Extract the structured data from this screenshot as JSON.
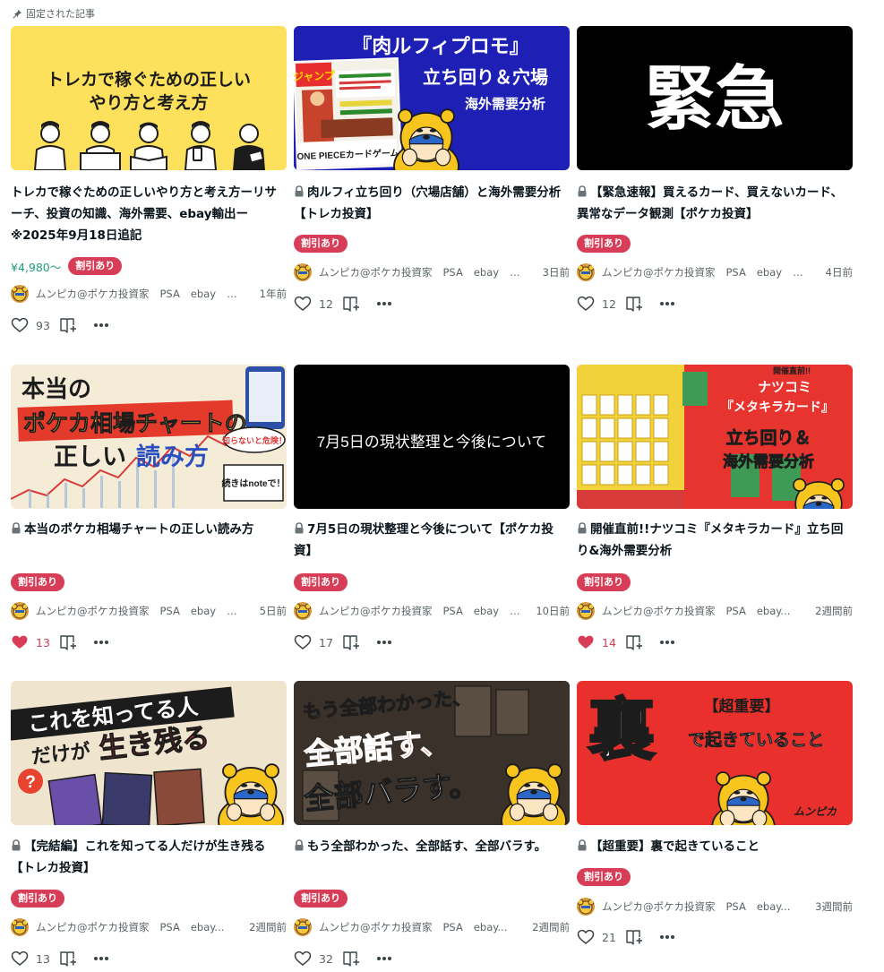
{
  "section_label": "固定された記事",
  "cards": [
    {
      "title": "トレカで稼ぐための正しいやり方と考え方ーリサーチ、投資の知識、海外需要、ebay輸出ー※2025年9月18日追記",
      "price": "¥4,980〜",
      "badge": "割引あり",
      "author": "ムンピカ@ポケカ投資家",
      "tags": [
        "PSA",
        "ebay"
      ],
      "ellipsis": "…",
      "time": "1年前",
      "likes": "93",
      "thumb": {
        "lines": [
          "トレカで稼ぐための正しい",
          "やり方と考え方"
        ]
      }
    },
    {
      "title": "肉ルフィ立ち回り（穴場店舗）と海外需要分析【トレカ投資】",
      "badge": "割引あり",
      "author": "ムンピカ@ポケカ投資家",
      "tags": [
        "PSA",
        "ebay"
      ],
      "ellipsis": "…",
      "time": "3日前",
      "likes": "12",
      "thumb": {
        "heading": "『肉ルフィプロモ』",
        "line1": "立ち回り＆穴場",
        "line2": "海外需要分析",
        "cover_logo": "ジャンプ",
        "cover_caption": "ONE PIECEカードゲーム"
      }
    },
    {
      "title": "【緊急速報】買えるカード、買えないカード、異常なデータ観測【ポケカ投資】",
      "badge": "割引あり",
      "author": "ムンピカ@ポケカ投資家",
      "tags": [
        "PSA",
        "ebay"
      ],
      "ellipsis": "…",
      "time": "4日前",
      "likes": "12",
      "thumb": {
        "text": "緊急"
      }
    },
    {
      "title": "本当のポケカ相場チャートの正しい読み方",
      "badge": "割引あり",
      "author": "ムンピカ@ポケカ投資家",
      "tags": [
        "PSA",
        "ebay"
      ],
      "ellipsis": "…",
      "time": "5日前",
      "likes": "13",
      "liked": true,
      "thumb": {
        "line1": "本当の",
        "line2": "ポケカ相場チャートの",
        "line3a": "正しい",
        "line3b": "読み方",
        "bubble": "知らないと危険！",
        "note": "続きはnoteで！"
      }
    },
    {
      "title": "7月5日の現状整理と今後について【ポケカ投資】",
      "badge": "割引あり",
      "author": "ムンピカ@ポケカ投資家",
      "tags": [
        "PSA",
        "ebay"
      ],
      "ellipsis": "…",
      "time": "10日前",
      "likes": "17",
      "thumb": {
        "text": "7月5日の現状整理と今後について"
      }
    },
    {
      "title": "開催直前!!ナツコミ『メタキラカード』立ち回り&海外需要分析",
      "badge": "割引あり",
      "author": "ムンピカ@ポケカ投資家",
      "tags": [
        "PSA",
        "ebay..."
      ],
      "ellipsis": "",
      "time": "2週間前",
      "likes": "14",
      "liked": true,
      "thumb": {
        "top": "開催直前!!",
        "line1": "ナツコミ",
        "line2": "『メタキラカード』",
        "line3": "立ち回り＆",
        "line4": "海外需要分析"
      }
    },
    {
      "title": "【完結編】これを知ってる人だけが生き残る【トレカ投資】",
      "badge": "割引あり",
      "author": "ムンピカ@ポケカ投資家",
      "tags": [
        "PSA",
        "ebay..."
      ],
      "ellipsis": "",
      "time": "2週間前",
      "likes": "13",
      "thumb": {
        "line1": "これを知ってる人",
        "line2a": "だけが",
        "line2b": "生き残る",
        "mark": "?"
      }
    },
    {
      "title": "もう全部わかった、全部話す、全部バラす。",
      "badge": "割引あり",
      "author": "ムンピカ@ポケカ投資家",
      "tags": [
        "PSA",
        "ebay..."
      ],
      "ellipsis": "",
      "time": "2週間前",
      "likes": "32",
      "thumb": {
        "line1": "もう全部わかった、",
        "line2": "全部話す、",
        "line3": "全部バラす。"
      }
    },
    {
      "title": "【超重要】裏で起きていること",
      "badge": "割引あり",
      "author": "ムンピカ@ポケカ投資家",
      "tags": [
        "PSA",
        "ebay..."
      ],
      "ellipsis": "",
      "time": "3週間前",
      "likes": "21",
      "thumb": {
        "big": "裏",
        "line1": "【超重要】",
        "line2": "で起きていること",
        "sign": "ムンピカ"
      }
    }
  ]
}
